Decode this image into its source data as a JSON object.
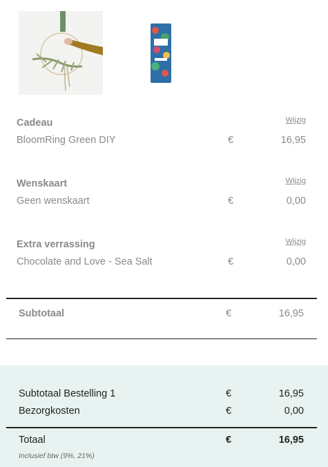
{
  "items": [
    {
      "title": "Cadeau",
      "edit": "Wijzig",
      "name": "BloomRing Green DIY",
      "currency": "€",
      "amount": "16,95"
    },
    {
      "title": "Wenskaart",
      "edit": "Wijzig",
      "name": "Geen wenskaart",
      "currency": "€",
      "amount": "0,00"
    },
    {
      "title": "Extra verrassing",
      "edit": "Wijzig",
      "name": "Chocolate and Love - Sea Salt",
      "currency": "€",
      "amount": "0,00"
    }
  ],
  "subtotal": {
    "label": "Subtotaal",
    "currency": "€",
    "amount": "16,95"
  },
  "summary": {
    "order_subtotal": {
      "label": "Subtotaal Bestelling 1",
      "currency": "€",
      "amount": "16,95"
    },
    "shipping": {
      "label": "Bezorgkosten",
      "currency": "€",
      "amount": "0,00"
    },
    "total": {
      "label": "Totaal",
      "currency": "€",
      "amount": "16,95"
    },
    "vat_note": "Inclusief btw (9%, 21%)"
  },
  "colors": {
    "summary_bg": "#e8f3f1",
    "text_muted": "#8a8a8a",
    "text_dark": "#222222"
  }
}
